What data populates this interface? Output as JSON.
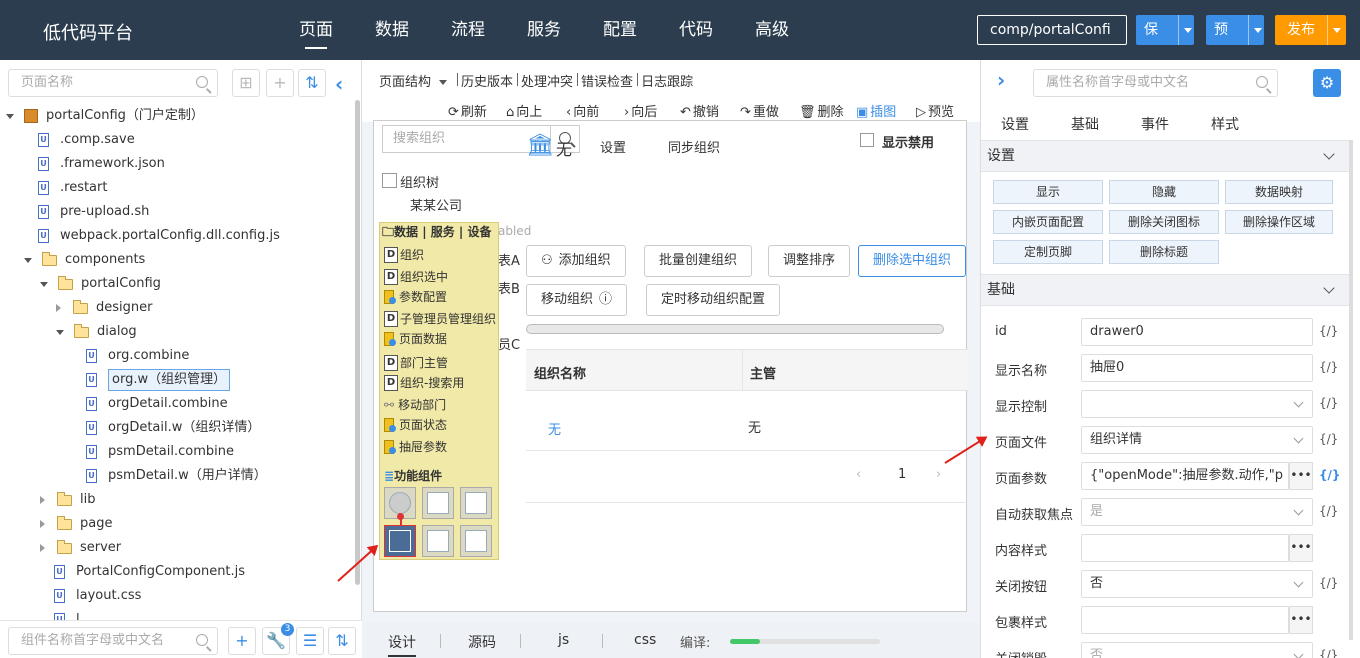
{
  "header": {
    "brand": "低代码平台",
    "nav": [
      "页面",
      "数据",
      "流程",
      "服务",
      "配置",
      "代码",
      "高级"
    ],
    "active_nav": "页面",
    "component_select": "comp/portalConfi",
    "save_label": "保存",
    "preview_label": "预览",
    "publish_label": "发布"
  },
  "left": {
    "search_placeholder": "页面名称",
    "tree": [
      {
        "label": "portalConfig（门户定制）",
        "type": "pkg",
        "level": 0,
        "expand": "down"
      },
      {
        "label": ".comp.save",
        "type": "file",
        "level": 1
      },
      {
        "label": ".framework.json",
        "type": "file",
        "level": 1
      },
      {
        "label": ".restart",
        "type": "file",
        "level": 1
      },
      {
        "label": "pre-upload.sh",
        "type": "file",
        "level": 1
      },
      {
        "label": "webpack.portalConfig.dll.config.js",
        "type": "file",
        "level": 1
      },
      {
        "label": "components",
        "type": "folder",
        "level": 1,
        "expand": "down"
      },
      {
        "label": "portalConfig",
        "type": "folder",
        "level": 2,
        "expand": "down"
      },
      {
        "label": "designer",
        "type": "folder",
        "level": 3,
        "expand": "right"
      },
      {
        "label": "dialog",
        "type": "folder",
        "level": 3,
        "expand": "down"
      },
      {
        "label": "org.combine",
        "type": "file",
        "level": 4
      },
      {
        "label": "org.w（组织管理）",
        "type": "file",
        "level": 4,
        "selected": true
      },
      {
        "label": "orgDetail.combine",
        "type": "file",
        "level": 4
      },
      {
        "label": "orgDetail.w（组织详情）",
        "type": "file",
        "level": 4
      },
      {
        "label": "psmDetail.combine",
        "type": "file",
        "level": 4
      },
      {
        "label": "psmDetail.w（用户详情）",
        "type": "file",
        "level": 4
      },
      {
        "label": "lib",
        "type": "folder",
        "level": 2,
        "expand": "right"
      },
      {
        "label": "page",
        "type": "folder",
        "level": 2,
        "expand": "right"
      },
      {
        "label": "server",
        "type": "folder",
        "level": 2,
        "expand": "right"
      },
      {
        "label": "PortalConfigComponent.js",
        "type": "file",
        "level": 2
      },
      {
        "label": "layout.css",
        "type": "file",
        "level": 2
      },
      {
        "label": "l...",
        "type": "file",
        "level": 2
      }
    ],
    "component_search_placeholder": "组件名称首字母或中文名",
    "wrench_badge": "3"
  },
  "center": {
    "tabs": [
      "页面结构",
      "历史版本",
      "处理冲突",
      "错误检查",
      "日志跟踪"
    ],
    "tools": [
      {
        "icon": "⟳",
        "label": "刷新"
      },
      {
        "icon": "⌂",
        "label": "向上"
      },
      {
        "icon": "‹",
        "label": "向前"
      },
      {
        "icon": "›",
        "label": "向后"
      },
      {
        "icon": "↶",
        "label": "撤销"
      },
      {
        "icon": "↷",
        "label": "重做"
      },
      {
        "icon": "🗑",
        "label": "删除"
      },
      {
        "icon": "▣",
        "label": "插图"
      },
      {
        "icon": "▷",
        "label": "预览"
      }
    ],
    "org_search_placeholder": "搜索组织",
    "none_label": "无",
    "settings_label": "设置",
    "sync_label": "同步组织",
    "show_disabled_label": "显示禁用",
    "org_tree_label": "组织树",
    "company_label": "某某公司",
    "hidden_texts": [
      "abled",
      "表A",
      "表B",
      "员C"
    ],
    "buttons_row1": [
      "添加组织",
      "批量创建组织",
      "调整排序",
      "删除选中组织"
    ],
    "buttons_row2": [
      "移动组织",
      "定时移动组织配置"
    ],
    "grid_headers": [
      "组织名称",
      "主管"
    ],
    "grid_row": [
      "无",
      "无"
    ],
    "page_number": "1",
    "bottom_tabs": [
      "设计",
      "源码",
      "js",
      "css"
    ],
    "compile_label": "编译:",
    "compile_progress": 0.2
  },
  "palette": {
    "header": "数据 | 服务 | 设备",
    "items": [
      {
        "icon": "D",
        "label": "组织"
      },
      {
        "icon": "D",
        "label": "组织选中"
      },
      {
        "icon": "db",
        "label": "参数配置"
      },
      {
        "icon": "D",
        "label": "子管理员管理组织"
      },
      {
        "icon": "db",
        "label": "页面数据"
      },
      {
        "icon": "D",
        "label": "部门主管"
      },
      {
        "icon": "D",
        "label": "组织-搜索用"
      },
      {
        "icon": "link",
        "label": "移动部门"
      },
      {
        "icon": "db",
        "label": "页面状态"
      },
      {
        "icon": "db",
        "label": "抽屉参数"
      }
    ],
    "func_label": "功能组件"
  },
  "right": {
    "search_placeholder": "属性名称首字母或中文名",
    "tabs": [
      "设置",
      "基础",
      "事件",
      "样式"
    ],
    "section_settings": "设置",
    "setting_buttons": [
      "显示",
      "隐藏",
      "数据映射",
      "内嵌页面配置",
      "删除关闭图标",
      "删除操作区域",
      "定制页脚",
      "删除标题"
    ],
    "section_basic": "基础",
    "props": [
      {
        "label": "id",
        "value": "drawer0",
        "kind": "text",
        "expr": "{/}"
      },
      {
        "label": "显示名称",
        "value": "抽屉0",
        "kind": "text",
        "expr": "{/}"
      },
      {
        "label": "显示控制",
        "value": "",
        "kind": "dd",
        "expr": "{/}"
      },
      {
        "label": "页面文件",
        "value": "组织详情",
        "kind": "dd",
        "expr": "{/}"
      },
      {
        "label": "页面参数",
        "value": "{\"openMode\":抽屉参数.动作,\"p",
        "kind": "more",
        "expr": "{/}",
        "expr_blue": true
      },
      {
        "label": "自动获取焦点",
        "value": "是",
        "kind": "dd-muted",
        "expr": "{/}"
      },
      {
        "label": "内容样式",
        "value": "",
        "kind": "more-short",
        "expr": ""
      },
      {
        "label": "关闭按钮",
        "value": "否",
        "kind": "dd",
        "expr": "{/}"
      },
      {
        "label": "包裹样式",
        "value": "",
        "kind": "more-short",
        "expr": ""
      },
      {
        "label": "关闭销毁",
        "value": "否",
        "kind": "dd-muted",
        "expr": "{/}"
      }
    ]
  },
  "colors": {
    "topbar": "#2b3d4f",
    "accent": "#3a8ee6",
    "publish": "#ff9a00",
    "annotation_arrow": "#e0201a"
  }
}
